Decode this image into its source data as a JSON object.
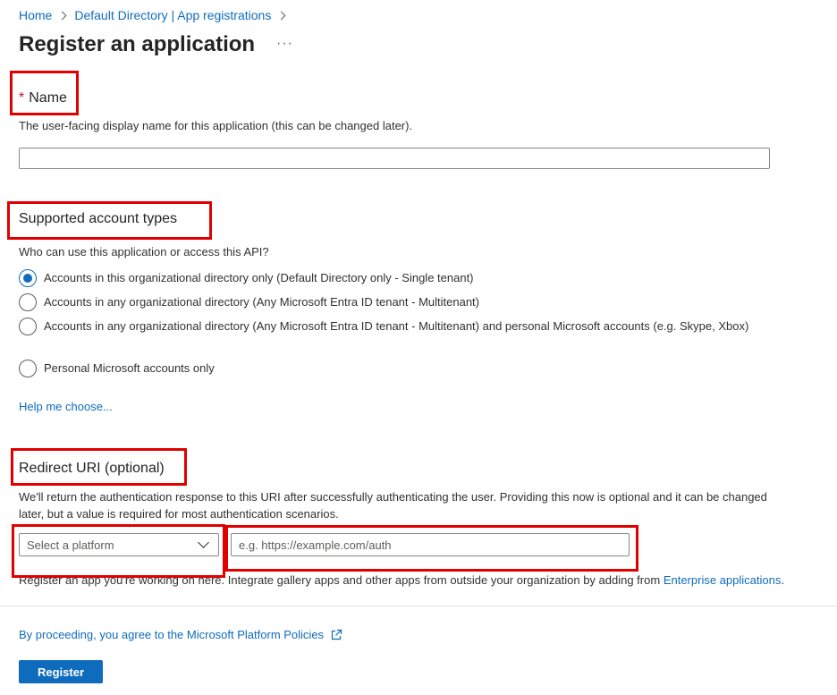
{
  "breadcrumb": {
    "items": [
      "Home",
      "Default Directory | App registrations"
    ]
  },
  "page": {
    "title": "Register an application",
    "more": "···"
  },
  "name_section": {
    "required_mark": "*",
    "title": "Name",
    "description": "The user-facing display name for this application (this can be changed later).",
    "value": ""
  },
  "account_types": {
    "title": "Supported account types",
    "question": "Who can use this application or access this API?",
    "options": [
      {
        "label": "Accounts in this organizational directory only (Default Directory only - Single tenant)",
        "checked": true
      },
      {
        "label": "Accounts in any organizational directory (Any Microsoft Entra ID tenant - Multitenant)",
        "checked": false
      },
      {
        "label": "Accounts in any organizational directory (Any Microsoft Entra ID tenant - Multitenant) and personal Microsoft accounts (e.g. Skype, Xbox)",
        "checked": false
      },
      {
        "label": "Personal Microsoft accounts only",
        "checked": false
      }
    ],
    "help_link": "Help me choose..."
  },
  "redirect": {
    "title": "Redirect URI (optional)",
    "description": "We'll return the authentication response to this URI after successfully authenticating the user. Providing this now is optional and it can be changed later, but a value is required for most authentication scenarios.",
    "platform_placeholder": "Select a platform",
    "uri_placeholder": "e.g. https://example.com/auth",
    "note": "Register an app you're working on here. Integrate gallery apps and other apps from outside your organization by adding from",
    "note_link": "Enterprise applications",
    "note_end": "."
  },
  "footer": {
    "policy_text": "By proceeding, you agree to the Microsoft Platform Policies",
    "register_label": "Register"
  },
  "colors": {
    "accent": "#0f6cbd",
    "highlight": "#e00000",
    "required": "#c50f1f"
  }
}
